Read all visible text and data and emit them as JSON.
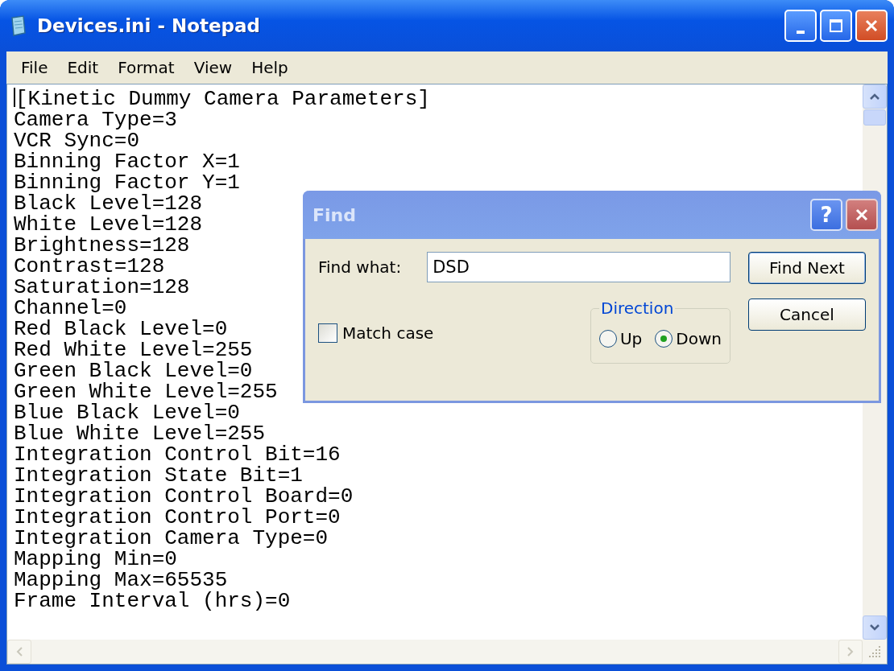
{
  "window": {
    "title": "Devices.ini - Notepad"
  },
  "menu": [
    {
      "label": "File"
    },
    {
      "label": "Edit"
    },
    {
      "label": "Format"
    },
    {
      "label": "View"
    },
    {
      "label": "Help"
    }
  ],
  "lines": [
    "[Kinetic Dummy Camera Parameters]",
    "Camera Type=3",
    "VCR Sync=0",
    "Binning Factor X=1",
    "Binning Factor Y=1",
    "Black Level=128",
    "White Level=128",
    "Brightness=128",
    "Contrast=128",
    "Saturation=128",
    "Channel=0",
    "Red Black Level=0",
    "Red White Level=255",
    "Green Black Level=0",
    "Green White Level=255",
    "Blue Black Level=0",
    "Blue White Level=255",
    "Integration Control Bit=16",
    "Integration State Bit=1",
    "Integration Control Board=0",
    "Integration Control Port=0",
    "Integration Camera Type=0",
    "Mapping Min=0",
    "Mapping Max=65535",
    "Frame Interval (hrs)=0"
  ],
  "find_dialog": {
    "title": "Find",
    "help": "?",
    "find_what_label": "Find what:",
    "find_what_value": "DSD",
    "find_next": "Find Next",
    "cancel": "Cancel",
    "direction_label": "Direction",
    "directions": [
      {
        "label": "Up",
        "selected": false
      },
      {
        "label": "Down",
        "selected": true
      }
    ],
    "match_case": {
      "label": "Match case",
      "checked": false
    }
  }
}
